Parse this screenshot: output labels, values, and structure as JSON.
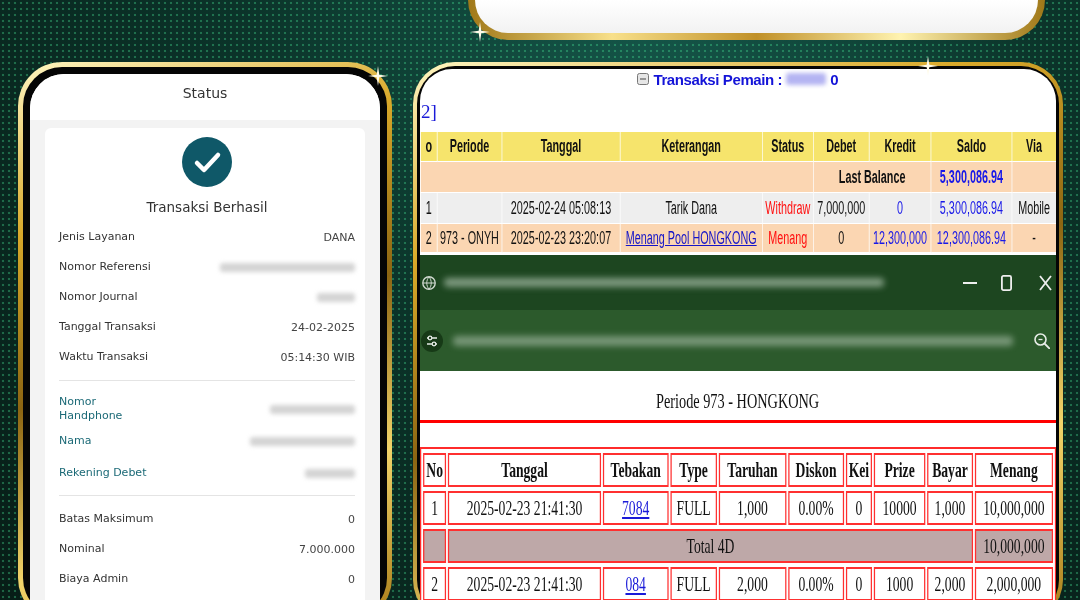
{
  "receipt": {
    "title": "Status",
    "result": "Transaksi Berhasil",
    "sections": [
      {
        "kind": "detail",
        "rows": [
          {
            "label": "Jenis Layanan",
            "value": "DANA",
            "redacted": false
          },
          {
            "label": "Nomor Referensi",
            "redacted": true
          },
          {
            "label": "Nomor Journal",
            "redacted": true
          },
          {
            "label": "Tanggal Transaksi",
            "value": "24-02-2025",
            "redacted": false
          },
          {
            "label": "Waktu Transaksi",
            "value": "05:14:30 WIB",
            "redacted": false
          }
        ]
      },
      {
        "kind": "account",
        "rows": [
          {
            "label": "Nomor Handphone",
            "redacted": true
          },
          {
            "label": "Nama",
            "redacted": true
          },
          {
            "label": "Rekening Debet",
            "redacted": true
          }
        ]
      },
      {
        "kind": "detail",
        "rows": [
          {
            "label": "Batas Maksimum",
            "value": "0",
            "redacted": false
          },
          {
            "label": "Nominal",
            "value": "7.000.000",
            "redacted": false
          },
          {
            "label": "Biaya Admin",
            "value": "0",
            "redacted": false
          }
        ]
      }
    ]
  },
  "ledger": {
    "title": "Transaksi Pemain :",
    "player_redacted": true,
    "player_code": "0",
    "pager": "2]",
    "columns": [
      "o",
      "Periode",
      "Tanggal",
      "Keterangan",
      "Status",
      "Debet",
      "Kredit",
      "Saldo",
      "Via"
    ],
    "balance": {
      "label": "Last Balance",
      "value": "5,300,086.94"
    },
    "rows": [
      {
        "no": "1",
        "tanggal": "2025-02-24 05:08:13",
        "keterangan": "Tarik Dana",
        "link": false,
        "status": "Withdraw",
        "debet": "7,000,000",
        "kredit": "0",
        "saldo": "5,300,086.94",
        "via": "Mobile"
      },
      {
        "no": "2",
        "periode": "973 - ONYH",
        "tanggal": "2025-02-23 23:20:07",
        "keterangan": "Menang Pool HONGKONG",
        "link": true,
        "status": "Menang",
        "debet": "0",
        "kredit": "12,300,000",
        "saldo": "12,300,086.94",
        "via": "-"
      }
    ]
  },
  "bet_page": {
    "title": "Periode 973 - HONGKONG",
    "columns": [
      "No",
      "Tanggal",
      "Tebakan",
      "Type",
      "Taruhan",
      "Diskon",
      "Kei",
      "Prize",
      "Bayar",
      "Menang"
    ],
    "rows": [
      {
        "kind": "bet",
        "no": "1",
        "tanggal": "2025-02-23 21:41:30",
        "tebakan": "7084",
        "type": "FULL",
        "taruhan": "1,000",
        "diskon": "0.00%",
        "kei": "0",
        "prize": "10000",
        "bayar": "1,000",
        "menang": "10,000,000"
      },
      {
        "kind": "total",
        "label": "Total 4D",
        "menang": "10,000,000"
      },
      {
        "kind": "bet",
        "no": "2",
        "tanggal": "2025-02-23 21:41:30",
        "tebakan": "084",
        "type": "FULL",
        "taruhan": "2,000",
        "diskon": "0.00%",
        "kei": "0",
        "prize": "1000",
        "bayar": "2,000",
        "menang": "2,000,000"
      }
    ]
  }
}
